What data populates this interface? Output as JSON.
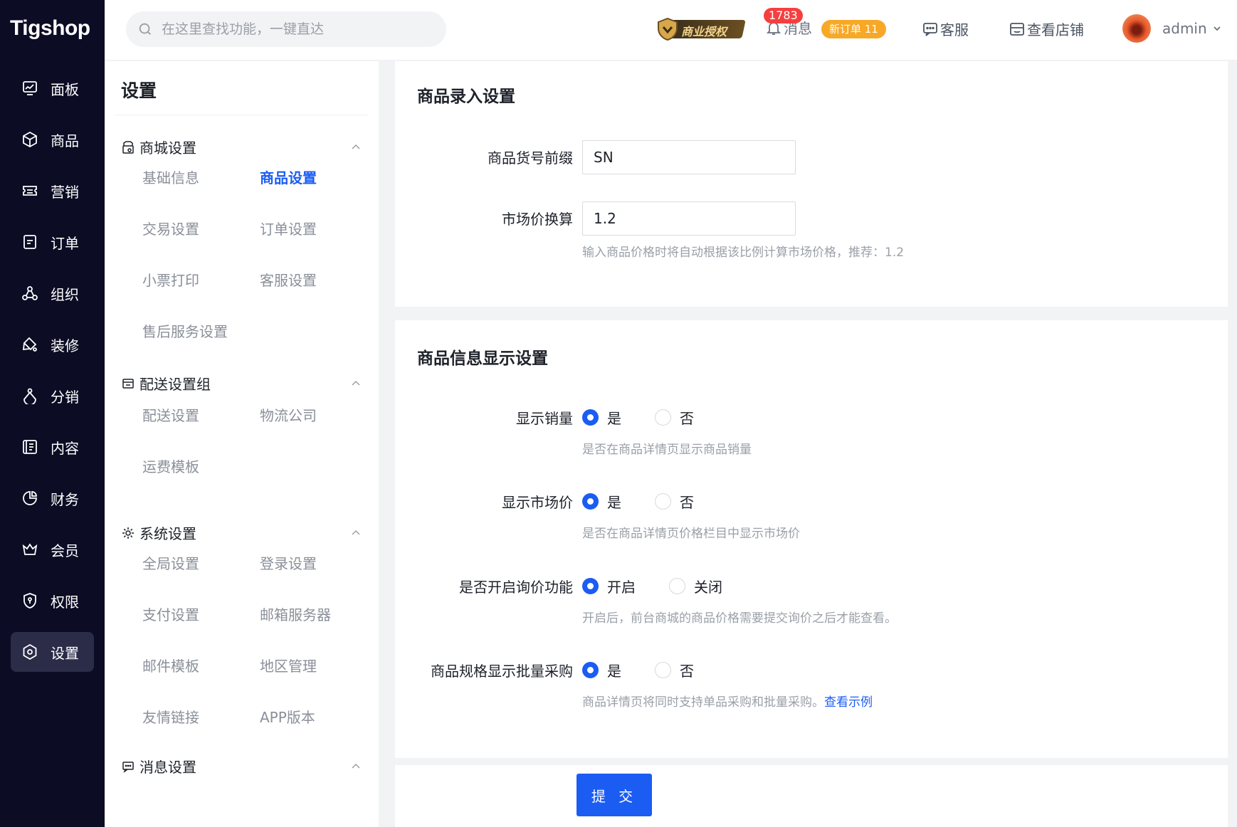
{
  "app": {
    "logo": "Tigshop"
  },
  "nav": [
    {
      "label": "面板",
      "icon": "dashboard-icon"
    },
    {
      "label": "商品",
      "icon": "box-icon"
    },
    {
      "label": "营销",
      "icon": "ticket-icon"
    },
    {
      "label": "订单",
      "icon": "document-icon"
    },
    {
      "label": "组织",
      "icon": "organization-icon"
    },
    {
      "label": "装修",
      "icon": "paint-icon"
    },
    {
      "label": "分销",
      "icon": "distribution-icon"
    },
    {
      "label": "内容",
      "icon": "content-icon"
    },
    {
      "label": "财务",
      "icon": "pie-chart-icon"
    },
    {
      "label": "会员",
      "icon": "crown-icon"
    },
    {
      "label": "权限",
      "icon": "shield-icon"
    },
    {
      "label": "设置",
      "icon": "gear-icon",
      "active": true
    }
  ],
  "header": {
    "search_placeholder": "在这里查找功能，一键直达",
    "license_label": "商业授权",
    "message_count": "1783",
    "message_label": "消息",
    "new_order_badge": "新订单 11",
    "service_label": "客服",
    "view_store_label": "查看店铺",
    "user_name": "admin"
  },
  "settings_menu": {
    "title": "设置",
    "groups": [
      {
        "title": "商城设置",
        "items": [
          "基础信息",
          "商品设置",
          "交易设置",
          "订单设置",
          "小票打印",
          "客服设置",
          "售后服务设置"
        ],
        "active": "商品设置"
      },
      {
        "title": "配送设置组",
        "items": [
          "配送设置",
          "物流公司",
          "运费模板"
        ]
      },
      {
        "title": "系统设置",
        "items": [
          "全局设置",
          "登录设置",
          "支付设置",
          "邮箱服务器",
          "邮件模板",
          "地区管理",
          "友情链接",
          "APP版本"
        ]
      },
      {
        "title": "消息设置",
        "items": []
      }
    ]
  },
  "product_entry": {
    "title": "商品录入设置",
    "sn_prefix_label": "商品货号前缀",
    "sn_prefix_value": "SN",
    "market_ratio_label": "市场价换算",
    "market_ratio_value": "1.2",
    "market_ratio_hint": "输入商品价格时将自动根据该比例计算市场价格，推荐：1.2"
  },
  "product_display": {
    "title": "商品信息显示设置",
    "fields": [
      {
        "label": "显示销量",
        "options": [
          "是",
          "否"
        ],
        "selected": 0,
        "hint": "是否在商品详情页显示商品销量"
      },
      {
        "label": "显示市场价",
        "options": [
          "是",
          "否"
        ],
        "selected": 0,
        "hint": "是否在商品详情页价格栏目中显示市场价"
      },
      {
        "label": "是否开启询价功能",
        "options": [
          "开启",
          "关闭"
        ],
        "selected": 0,
        "hint": "开启后，前台商城的商品价格需要提交询价之后才能查看。"
      },
      {
        "label": "商品规格显示批量采购",
        "options": [
          "是",
          "否"
        ],
        "selected": 0,
        "hint": "商品详情页将同时支持单品采购和批量采购。",
        "hint_link": "查看示例"
      }
    ]
  },
  "submit_label": "提 交",
  "colors": {
    "primary": "#1b5cf3",
    "sidebar": "#0c0c25",
    "badge_red": "#f53f3f",
    "badge_orange": "#f7a826"
  }
}
